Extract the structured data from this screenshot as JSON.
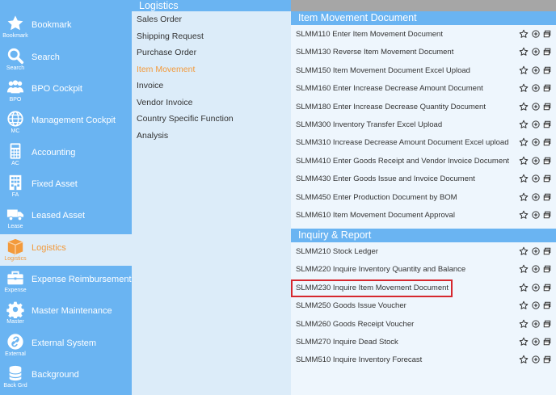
{
  "sidebar": {
    "items": [
      {
        "label": "Bookmark",
        "short": "Bookmark",
        "icon": "star-icon"
      },
      {
        "label": "Search",
        "short": "Search",
        "icon": "search-icon"
      },
      {
        "label": "BPO Cockpit",
        "short": "BPO",
        "icon": "users-icon"
      },
      {
        "label": "Management Cockpit",
        "short": "MC",
        "icon": "globe-icon"
      },
      {
        "label": "Accounting",
        "short": "AC",
        "icon": "calculator-icon"
      },
      {
        "label": "Fixed Asset",
        "short": "FA",
        "icon": "building-icon"
      },
      {
        "label": "Leased Asset",
        "short": "Lease",
        "icon": "truck-icon"
      },
      {
        "label": "Logistics",
        "short": "Logistics",
        "icon": "box-icon"
      },
      {
        "label": "Expense Reimbursement",
        "short": "Expense",
        "icon": "briefcase-icon"
      },
      {
        "label": "Master Maintenance",
        "short": "Master",
        "icon": "gear-icon"
      },
      {
        "label": "External System",
        "short": "External",
        "icon": "link-icon"
      },
      {
        "label": "Background",
        "short": "Back Grd",
        "icon": "database-icon"
      }
    ],
    "active_index": 7
  },
  "submenu": {
    "title": "Logistics",
    "items": [
      "Sales Order",
      "Shipping Request",
      "Purchase Order",
      "Item Movement",
      "Invoice",
      "Vendor Invoice",
      "Country Specific Function",
      "Analysis"
    ],
    "active_index": 3
  },
  "sections": [
    {
      "title": "Item Movement Document",
      "rows": [
        "SLMM110 Enter Item Movement Document",
        "SLMM130 Reverse Item Movement Document",
        "SLMM150 Item Movement Document Excel Upload",
        "SLMM160 Enter Increase Decrease Amount Document",
        "SLMM180 Enter Increase Decrease Quantity Document",
        "SLMM300 Inventory Transfer Excel Upload",
        "SLMM310 Increase Decrease Amount Document Excel upload",
        "SLMM410 Enter Goods Receipt and Vendor Invoice Document",
        "SLMM430 Enter Goods Issue and Invoice Document",
        "SLMM450 Enter Production Document by BOM",
        "SLMM610 Item Movement Document Approval"
      ]
    },
    {
      "title": "Inquiry & Report",
      "rows": [
        "SLMM210 Stock Ledger",
        "SLMM220 Inquire Inventory Quantity and Balance",
        "SLMM230 Inquire Item Movement Document",
        "SLMM250 Goods Issue Voucher",
        "SLMM260 Goods Receipt Voucher",
        "SLMM270 Inquire Dead Stock",
        "SLMM510 Inquire Inventory Forecast"
      ]
    }
  ],
  "row_icons": [
    "star-outline-icon",
    "circle-plus-icon",
    "window-icon"
  ],
  "colors": {
    "sidebar": "#6ab4f2",
    "active_bg": "#dcecf9",
    "active_text": "#f39a3b",
    "highlight": "#d6282e"
  }
}
